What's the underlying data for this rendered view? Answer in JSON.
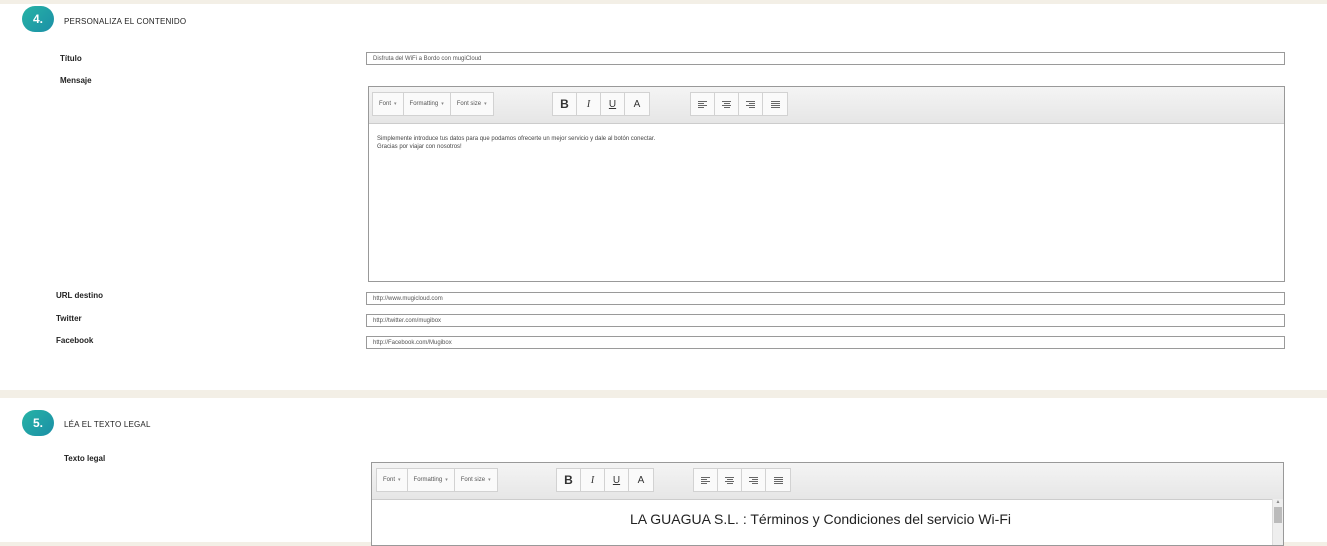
{
  "section4": {
    "number": "4.",
    "title": "PERSONALIZA EL CONTENIDO",
    "fields": {
      "titulo": {
        "label": "Título",
        "value": "Disfruta del WiFi a Bordo con mugiCloud"
      },
      "mensaje": {
        "label": "Mensaje"
      },
      "url": {
        "label": "URL destino",
        "value": "http://www.mugicloud.com"
      },
      "twitter": {
        "label": "Twitter",
        "value": "http://twitter.com/mugibox"
      },
      "facebook": {
        "label": "Facebook",
        "value": "http://Facebook.com/Mugibox"
      }
    },
    "editor": {
      "line1": "Simplemente introduce tus datos para que podamos ofrecerte un mejor servicio y dale al botón conectar.",
      "line2": "Gracias por viajar con nosotros!"
    }
  },
  "section5": {
    "number": "5.",
    "title": "LÉA EL TEXTO LEGAL",
    "label": "Texto legal",
    "heading": "LA GUAGUA S.L. : Términos y Condiciones del servicio Wi-Fi"
  },
  "toolbar": {
    "font": "Font",
    "formatting": "Formatting",
    "font_size": "Font size",
    "bold": "B",
    "italic": "I",
    "underline": "U",
    "color": "A",
    "caret": "▾"
  }
}
